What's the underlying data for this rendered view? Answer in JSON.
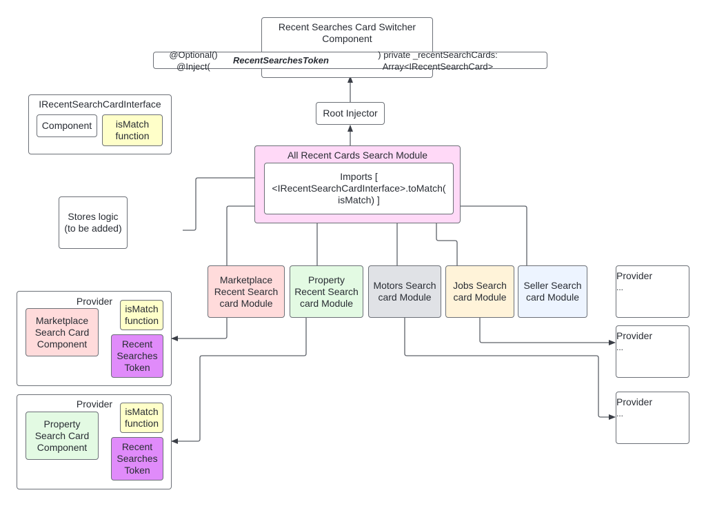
{
  "colors": {
    "switcher": "#d5f7f3",
    "module": "#ffd9f7",
    "marketplace": "#ffdbdb",
    "property": "#e3fae3",
    "motors": "#e0e2e6",
    "jobs": "#fff3d9",
    "seller": "#edf4ff",
    "ismatch": "#ffffc9",
    "token": "#e08bfa"
  },
  "switcher": {
    "title": "Recent Searches Card Switcher\nComponent",
    "injection_prefix": "@Optional() @Inject(",
    "injection_token": "RecentSearchesToken",
    "injection_suffix": ") private _recentSearchCards: Array<IRecentSearchCard>"
  },
  "interface": {
    "title": "IRecentSearchCardInterface",
    "component": "Component",
    "ismatch": "isMatch\nfunction"
  },
  "root_injector": "Root Injector",
  "all_module": {
    "title": "All Recent Cards Search Module",
    "imports": "Imports [\n<IRecentSearchCardInterface>.toMatch(\nisMatch) ]"
  },
  "stores": "Stores logic\n(to be added)",
  "modules": [
    {
      "label": "Marketplace\nRecent Search\ncard Module"
    },
    {
      "label": "Property\nRecent Search\ncard Module"
    },
    {
      "label": "Motors Search\ncard Module"
    },
    {
      "label": "Jobs Search\ncard Module"
    },
    {
      "label": "Seller Search\ncard Module"
    }
  ],
  "providers": [
    {
      "title": "Provider",
      "component": "Marketplace\nSearch Card\nComponent",
      "ismatch": "isMatch\nfunction",
      "token": "Recent\nSearches\nToken"
    },
    {
      "title": "Provider",
      "component": "Property\nSearch Card\nComponent",
      "ismatch": "isMatch\nfunction",
      "token": "Recent\nSearches\nToken"
    }
  ],
  "placeholder_providers": [
    {
      "title": "Provider",
      "body": "..."
    },
    {
      "title": "Provider",
      "body": "..."
    },
    {
      "title": "Provider",
      "body": "..."
    }
  ]
}
